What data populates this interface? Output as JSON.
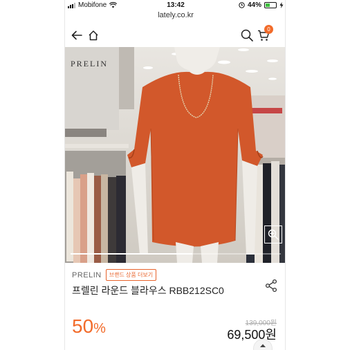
{
  "status_bar": {
    "carrier": "Mobifone",
    "time": "13:42",
    "battery": "44%"
  },
  "browser": {
    "url": "lately.co.kr"
  },
  "header": {
    "cart_count": "0"
  },
  "product": {
    "image_sign_text": "PRELIN",
    "image_slide_progress": 0.58,
    "brand": "PRELIN",
    "brand_more_label": "브랜드 상품 더보기",
    "title": "프렐린 라운드 블라우스 RBB212SC0",
    "discount_value": "50",
    "discount_unit": "%",
    "original_price": "139,000원",
    "price": "69,500원"
  },
  "colors": {
    "accent": "#f26b2a",
    "blouse": "#d2582b"
  },
  "icons": [
    "back-arrow-icon",
    "home-icon",
    "search-icon",
    "cart-icon",
    "zoom-in-icon",
    "share-icon",
    "chevron-up-icon",
    "wifi-icon",
    "alarm-icon",
    "charging-icon"
  ]
}
